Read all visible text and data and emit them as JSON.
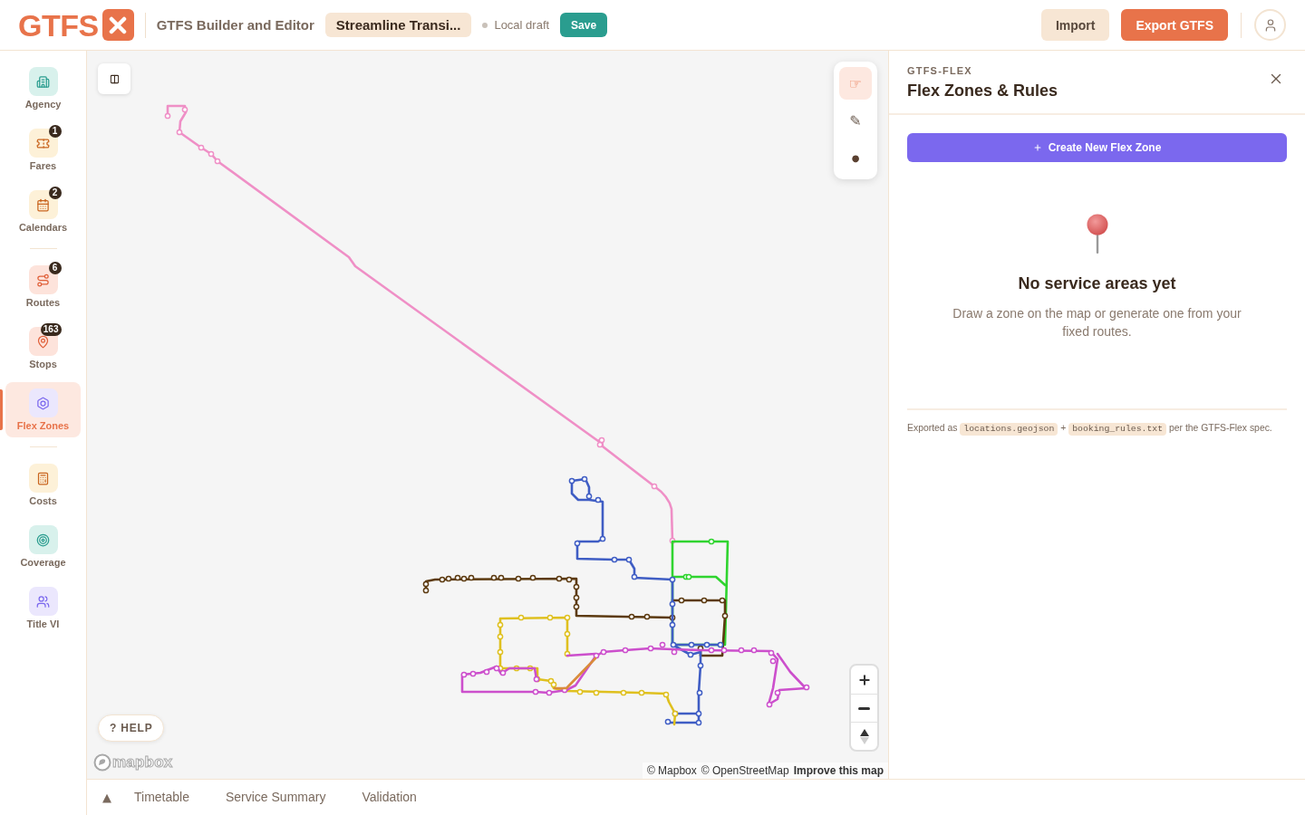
{
  "header": {
    "logo": "GTFS",
    "app_title": "GTFS Builder and Editor",
    "project_name": "Streamline Transi...",
    "status": "Local draft",
    "save_button": "Save",
    "actions": [
      {
        "kind": "secondary",
        "label": "Import"
      },
      {
        "kind": "primary",
        "label": "Export GTFS"
      }
    ]
  },
  "sidebar": {
    "sections": [
      {
        "items": [
          {
            "kind": "agency",
            "label": "Agency",
            "selected": false
          },
          {
            "kind": "fares",
            "label": "Fares",
            "badge": "1",
            "selected": false
          },
          {
            "kind": "calendars",
            "label": "Calendars",
            "badge": "2",
            "selected": false
          }
        ]
      },
      {
        "items": [
          {
            "kind": "routes",
            "label": "Routes",
            "badge": "6",
            "selected": false
          },
          {
            "kind": "stops",
            "label": "Stops",
            "badge": "163",
            "selected": false
          },
          {
            "kind": "flexzones",
            "label": "Flex Zones",
            "selected": true
          }
        ]
      },
      {
        "items": [
          {
            "kind": "costs",
            "label": "Costs",
            "selected": false
          },
          {
            "kind": "coverage",
            "label": "Coverage",
            "selected": false
          },
          {
            "kind": "titlevi",
            "label": "Title VI",
            "selected": false
          }
        ]
      }
    ]
  },
  "map": {
    "tools": [
      {
        "glyph": "☞",
        "selected": true
      },
      {
        "glyph": "✎",
        "selected": false
      },
      {
        "glyph": "●",
        "selected": false
      }
    ],
    "help": "? HELP",
    "logo": "mapbox",
    "attribution": [
      {
        "kind": "credit",
        "label": "© Mapbox"
      },
      {
        "kind": "credit",
        "label": "© OpenStreetMap"
      },
      {
        "kind": "feedback",
        "label": "Improve this map"
      }
    ]
  },
  "panel": {
    "eyebrow": "GTFS-FLEX",
    "title": "Flex Zones & Rules",
    "create_button": "Create New Flex Zone",
    "empty_state": {
      "title": "No service areas yet",
      "description": "Draw a zone on the map or generate one from your fixed routes."
    },
    "footnote": [
      {
        "kind": "text",
        "text": "Exported as"
      },
      {
        "kind": "code",
        "text": "locations.geojson"
      },
      {
        "kind": "text",
        "text": "+"
      },
      {
        "kind": "code",
        "text": "booking_rules.txt"
      },
      {
        "kind": "text",
        "text": "per the GTFS-Flex spec."
      }
    ]
  },
  "bottom_bar": {
    "toggle": "▲",
    "tabs": [
      {
        "label": "Timetable",
        "selected": false
      },
      {
        "label": "Service Summary",
        "selected": false
      },
      {
        "label": "Validation",
        "selected": false
      }
    ]
  }
}
